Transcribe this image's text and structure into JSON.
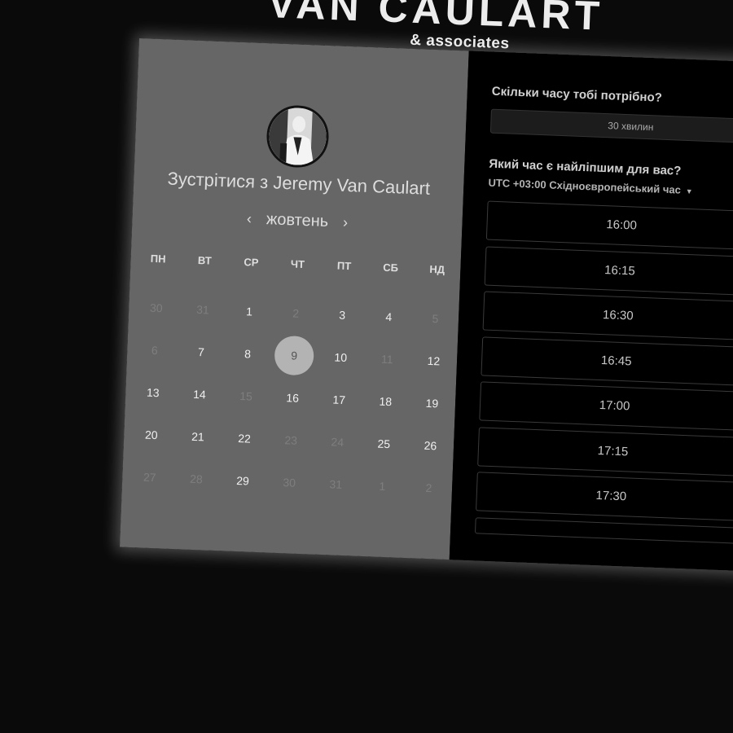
{
  "brand": {
    "name": "VAN CAULART",
    "sub": "& associates"
  },
  "calendar": {
    "avatar_name": "avatar",
    "meet_prefix": "Зустрітися з",
    "host": "Jeremy Van Caulart",
    "month": "жовтень",
    "prev_icon": "‹",
    "next_icon": "›",
    "weekdays": [
      "ПН",
      "ВТ",
      "СР",
      "ЧТ",
      "ПТ",
      "СБ",
      "НД"
    ],
    "days": [
      {
        "label": "30",
        "state": "muted"
      },
      {
        "label": "31",
        "state": "muted"
      },
      {
        "label": "1",
        "state": "available"
      },
      {
        "label": "2",
        "state": "muted"
      },
      {
        "label": "3",
        "state": "available"
      },
      {
        "label": "4",
        "state": "available"
      },
      {
        "label": "5",
        "state": "muted"
      },
      {
        "label": "6",
        "state": "muted"
      },
      {
        "label": "7",
        "state": "available"
      },
      {
        "label": "8",
        "state": "available"
      },
      {
        "label": "9",
        "state": "selected"
      },
      {
        "label": "10",
        "state": "available"
      },
      {
        "label": "11",
        "state": "muted"
      },
      {
        "label": "12",
        "state": "available"
      },
      {
        "label": "13",
        "state": "available"
      },
      {
        "label": "14",
        "state": "available"
      },
      {
        "label": "15",
        "state": "muted"
      },
      {
        "label": "16",
        "state": "available"
      },
      {
        "label": "17",
        "state": "available"
      },
      {
        "label": "18",
        "state": "available"
      },
      {
        "label": "19",
        "state": "available"
      },
      {
        "label": "20",
        "state": "available"
      },
      {
        "label": "21",
        "state": "available"
      },
      {
        "label": "22",
        "state": "available"
      },
      {
        "label": "23",
        "state": "muted"
      },
      {
        "label": "24",
        "state": "muted"
      },
      {
        "label": "25",
        "state": "available"
      },
      {
        "label": "26",
        "state": "available"
      },
      {
        "label": "27",
        "state": "muted"
      },
      {
        "label": "28",
        "state": "muted"
      },
      {
        "label": "29",
        "state": "available"
      },
      {
        "label": "30",
        "state": "muted"
      },
      {
        "label": "31",
        "state": "muted"
      },
      {
        "label": "1",
        "state": "muted"
      },
      {
        "label": "2",
        "state": "muted"
      }
    ]
  },
  "scheduler": {
    "duration_question": "Скільки часу тобі потрібно?",
    "duration_value": "30 хвилин",
    "time_question": "Який час є найліпшим для вас?",
    "timezone": "UTC +03:00 Східноєвропейський час",
    "timezone_caret_icon": "caret-down-icon",
    "slots": [
      "16:00",
      "16:15",
      "16:30",
      "16:45",
      "17:00",
      "17:15",
      "17:30"
    ]
  }
}
